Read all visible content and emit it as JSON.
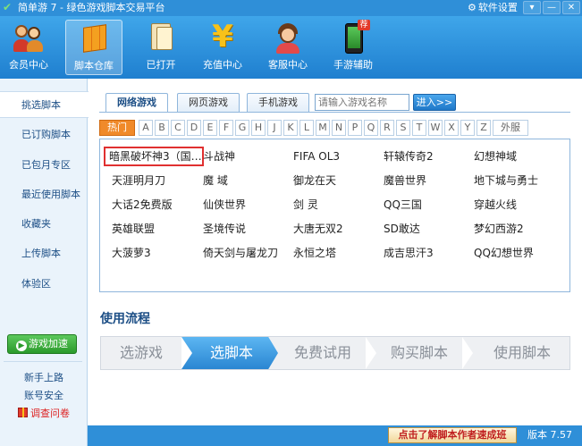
{
  "window": {
    "title": "简单游 7 - 绿色游戏脚本交易平台",
    "settings_label": "软件设置",
    "controls": [
      "▾",
      "—",
      "✕"
    ]
  },
  "toolbar": [
    {
      "label": "会员中心",
      "icon": "members-icon"
    },
    {
      "label": "脚本仓库",
      "icon": "script-store-icon",
      "active": true
    },
    {
      "label": "已打开",
      "icon": "opened-scripts-icon"
    },
    {
      "label": "充值中心",
      "icon": "yen-icon"
    },
    {
      "label": "客服中心",
      "icon": "customer-service-icon"
    },
    {
      "label": "手游辅助",
      "icon": "mobile-phone-icon",
      "badge": "荐"
    }
  ],
  "sidebar": {
    "items": [
      "挑选脚本",
      "已订购脚本",
      "已包月专区",
      "最近使用脚本",
      "收藏夹",
      "上传脚本",
      "体验区"
    ],
    "accelerate_button": "游戏加速",
    "links": [
      "新手上路",
      "账号安全",
      "调查问卷"
    ]
  },
  "tabs": [
    "网络游戏",
    "网页游戏",
    "手机游戏"
  ],
  "search": {
    "placeholder": "请输入游戏名称",
    "button": "进入>>"
  },
  "letters": [
    "热门",
    "A",
    "B",
    "C",
    "D",
    "E",
    "F",
    "G",
    "H",
    "J",
    "K",
    "L",
    "M",
    "N",
    "P",
    "Q",
    "R",
    "S",
    "T",
    "W",
    "X",
    "Y",
    "Z",
    "外服"
  ],
  "games": [
    [
      "暗黑破坏神3（国…",
      "斗战神",
      "FIFA OL3",
      "轩辕传奇2",
      "幻想神域"
    ],
    [
      "天涯明月刀",
      "魔 域",
      "御龙在天",
      "魔兽世界",
      "地下城与勇士"
    ],
    [
      "大话2免费版",
      "仙侠世界",
      "剑 灵",
      "QQ三国",
      "穿越火线"
    ],
    [
      "英雄联盟",
      "圣境传说",
      "大唐无双2",
      "SD敢达",
      "梦幻西游2"
    ],
    [
      "大菠萝3",
      "倚天剑与屠龙刀",
      "永恒之塔",
      "成吉思汗3",
      "QQ幻想世界"
    ]
  ],
  "flow": {
    "title": "使用流程",
    "steps": [
      "选游戏",
      "选脚本",
      "免费试用",
      "购买脚本",
      "使用脚本"
    ]
  },
  "footer": {
    "learn_button": "点击了解脚本作者速成班",
    "version": "版本 7.57"
  }
}
